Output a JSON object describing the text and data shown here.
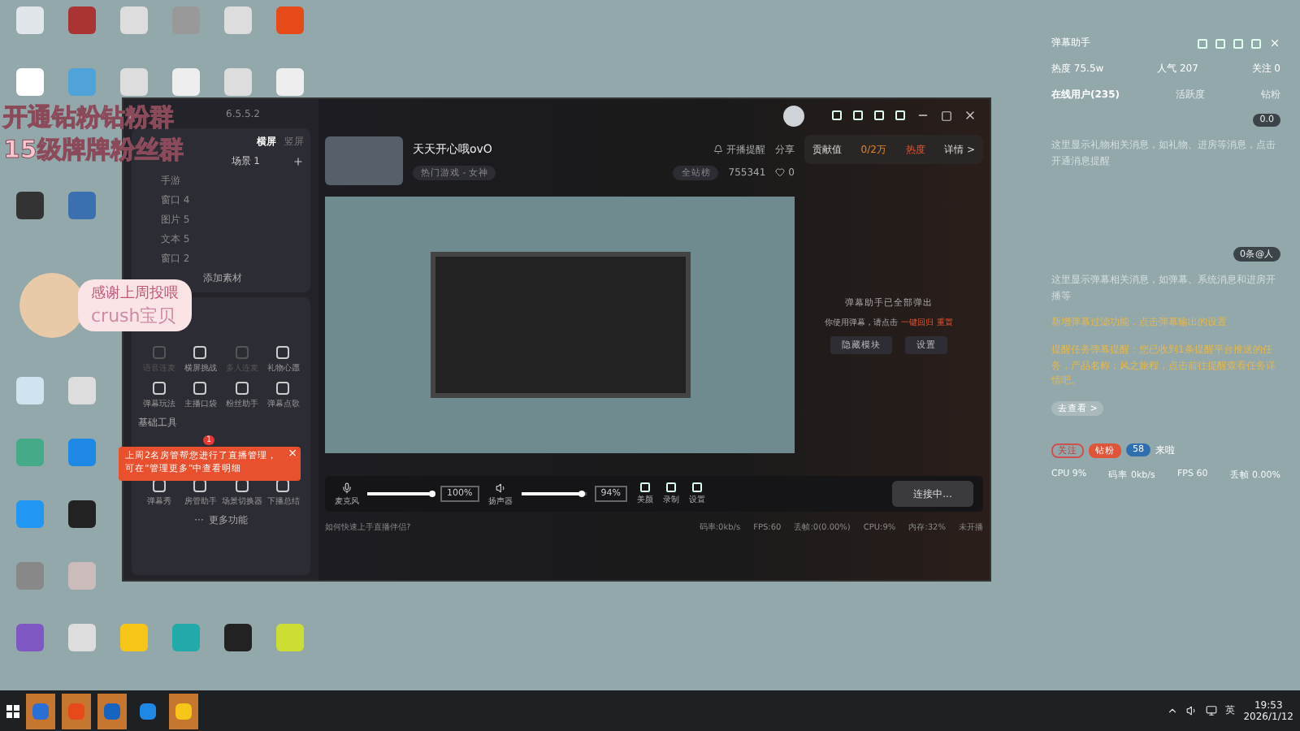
{
  "overlay": {
    "lines": [
      "开通钻粉钻粉群",
      "15级牌牌粉丝群"
    ],
    "sticker": [
      "感谢上周投喂",
      "crush宝贝"
    ]
  },
  "sidebar": {
    "version": "6.5.5.2",
    "orientation_tabs": [
      {
        "label": "横屏",
        "selected": true
      },
      {
        "label": "竖屏",
        "selected": false
      }
    ],
    "scene": "场景 1",
    "sources": [
      "手游",
      "窗口 4",
      "图片 5",
      "文本 5",
      "窗口 2"
    ],
    "add_source": "添加素材",
    "tools": [
      {
        "label": "语音连麦",
        "disabled": true
      },
      {
        "label": "横屏挑战",
        "disabled": false
      },
      {
        "label": "多人连麦",
        "disabled": true
      },
      {
        "label": "礼物心愿",
        "disabled": false
      },
      {
        "label": "弹幕玩法",
        "disabled": false
      },
      {
        "label": "主播口袋",
        "disabled": false
      },
      {
        "label": "粉丝助手",
        "disabled": false
      },
      {
        "label": "弹幕点歌",
        "disabled": false
      }
    ],
    "basic_title": "基础工具",
    "basic_badge": "1",
    "basic_tools": [
      "弹幕秀",
      "房管助手",
      "场景切换器",
      "下播总结"
    ],
    "more_icon": "···",
    "more": "更多功能",
    "toast": {
      "text": "上周2名房管帮您进行了直播管理，可在“管理更多”中查看明细",
      "close": "×"
    }
  },
  "room": {
    "title": "天天开心哦ovO",
    "category": "热门游戏 - 女神",
    "remind": "开播提醒",
    "share": "分享",
    "rank": "全站榜",
    "fans": "755341",
    "likes": "0",
    "contribution": {
      "label": "贡献值",
      "value": "0/2万",
      "heat": "热度",
      "detail": "详情 >"
    }
  },
  "preview_side": {
    "text": "弹幕助手已全部弹出",
    "hint": "你使用弹幕，请点击",
    "link": "一键回归",
    "reset": "重置",
    "buttons": [
      "隐藏模块",
      "设置"
    ]
  },
  "controls": {
    "mic": {
      "label": "麦克风",
      "level": 1.0,
      "reading": "100%"
    },
    "speaker": {
      "label": "扬声器",
      "level": 0.94,
      "reading": "94%"
    },
    "tools": [
      "美颜",
      "录制",
      "设置"
    ],
    "connect": "连接中..."
  },
  "status": {
    "help": "如何快速上手直播伴侣?",
    "items": [
      "码率:0kb/s",
      "FPS:60",
      "丢帧:0(0.00%)",
      "CPU:9%",
      "内存:32%",
      "未开播"
    ]
  },
  "assistant": {
    "title": "弹幕助手",
    "stats": [
      "热度 75.5w",
      "人气 207",
      "关注 0"
    ],
    "tabs": [
      {
        "label": "在线用户(235)",
        "selected": true
      },
      {
        "label": "活跃度",
        "selected": false
      },
      {
        "label": "钻粉",
        "selected": false
      }
    ],
    "notice": "这里显示礼物相关消息，如礼物、进房等消息，点击开通消息提醒",
    "gift_badge": "0.0",
    "at_badge": "0条@人",
    "notice2": "这里显示弹幕相关消息，如弹幕、系统消息和进房开播等",
    "tips": [
      "新增弹幕过滤功能，点击弹幕输出的设置",
      "提醒任务弹幕提醒：您已收到1条提醒平台推送的任务，产品名称：风之旅程，点击前往提醒查看任务详情吧。"
    ],
    "go": "去查看 >",
    "follow": "关注",
    "fan_badge": "钻粉",
    "level": "58",
    "welcome": "来啦",
    "status": [
      "CPU 9%",
      "码率 0kb/s",
      "FPS 60",
      "丢帧 0.00%"
    ]
  },
  "taskbar": {
    "apps": [
      {
        "selected": true
      },
      {
        "selected": true
      },
      {
        "selected": true
      },
      {
        "selected": false
      },
      {
        "selected": true
      }
    ],
    "ime": "英",
    "time": "19:53",
    "date": "2026/1/12"
  }
}
